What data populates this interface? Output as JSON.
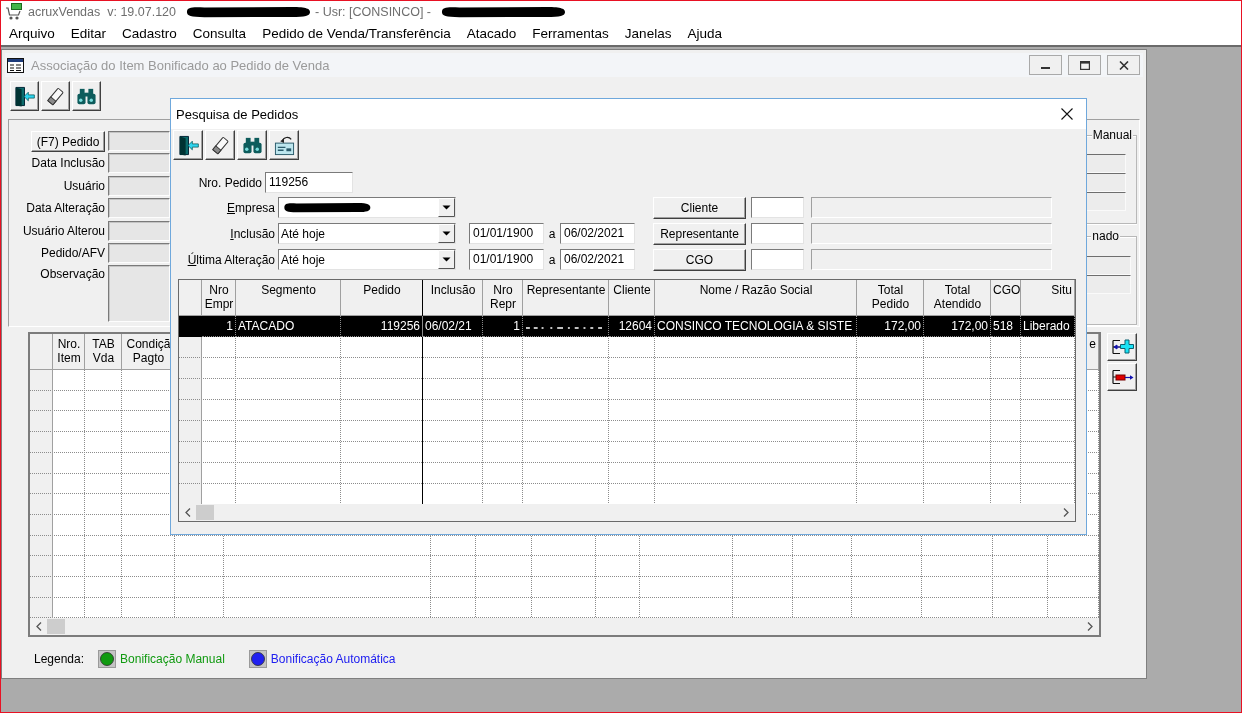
{
  "app": {
    "title_parts": [
      {
        "kind": "text",
        "text": "acruxVendas  v: 19.07.120"
      },
      {
        "kind": "redacted"
      },
      {
        "kind": "text",
        "text": "- Usr: [CONSINCO] -"
      },
      {
        "kind": "redacted"
      }
    ]
  },
  "menu": [
    "Arquivo",
    "Editar",
    "Cadastro",
    "Consulta",
    "Pedido de Venda/Transferência",
    "Atacado",
    "Ferramentas",
    "Janelas",
    "Ajuda"
  ],
  "child_window": {
    "title": "Associação do Item Bonificado ao Pedido de Venda",
    "toolbar": [
      {
        "kind": "exit"
      },
      {
        "kind": "eraser"
      },
      {
        "kind": "binoculars"
      }
    ],
    "fields": [
      {
        "kind": "button",
        "label": "(F7) Pedido"
      },
      {
        "kind": "text",
        "label": "Data Inclusão"
      },
      {
        "kind": "text",
        "label": "Usuário"
      },
      {
        "kind": "text",
        "label": "Data Alteração"
      },
      {
        "kind": "text",
        "label": "Usuário Alterou"
      },
      {
        "kind": "text",
        "label": "Pedido/AFV"
      },
      {
        "kind": "memo",
        "label": "Observação"
      }
    ],
    "groups": [
      {
        "title": "Manual"
      },
      {
        "title": "nado"
      }
    ],
    "grid": {
      "columns": [
        "Nro.\nItem",
        "TAB\nVda",
        "Condiçã\nPagto"
      ],
      "last_column": "e"
    },
    "side_buttons": [
      {
        "kind": "add"
      },
      {
        "kind": "remove"
      }
    ],
    "legend": {
      "label": "Legenda:",
      "items": [
        {
          "label": "Bonificação Manual",
          "color": "#109a10"
        },
        {
          "label": "Bonificação Automática",
          "color": "#2020f0"
        }
      ]
    }
  },
  "dialog": {
    "title": "Pesquisa de Pedidos",
    "toolbar": [
      {
        "kind": "exit"
      },
      {
        "kind": "eraser"
      },
      {
        "kind": "binoculars"
      },
      {
        "kind": "restore"
      }
    ],
    "order_number": {
      "label": "Nro. Pedido",
      "value": "119256"
    },
    "filters": [
      {
        "label": "Empresa",
        "mnemonic": true,
        "redacted": true
      },
      {
        "label": "Inclusão",
        "mnemonic": true,
        "value": "Até hoje",
        "from": "01/01/1900",
        "separator": "a",
        "to": "06/02/2021"
      },
      {
        "label": "Última Alteração",
        "mnemonic": true,
        "value": "Até hoje",
        "from": "01/01/1900",
        "separator": "a",
        "to": "06/02/2021"
      }
    ],
    "lookups": [
      "Cliente",
      "Representante",
      "CGO"
    ],
    "grid": {
      "columns": [
        "Nro\nEmpr",
        "Segmento",
        "Pedido",
        "Inclusão",
        "Nro\nRepr",
        "Representante",
        "Cliente",
        "Nome / Razão Social",
        "Total\nPedido",
        "Total\nAtendido",
        "CGO",
        "Situ"
      ],
      "rows": [
        {
          "selected": true,
          "cells": [
            {
              "text": "1"
            },
            {
              "text": "ATACADO"
            },
            {
              "text": "119256"
            },
            {
              "text": "06/02/21"
            },
            {
              "text": "1"
            },
            {
              "redacted": true
            },
            {
              "text": "12604"
            },
            {
              "text": "CONSINCO TECNOLOGIA & SISTE"
            },
            {
              "text": "172,00"
            },
            {
              "text": "172,00"
            },
            {
              "text": "518"
            },
            {
              "text": "Liberado"
            }
          ]
        }
      ]
    }
  }
}
